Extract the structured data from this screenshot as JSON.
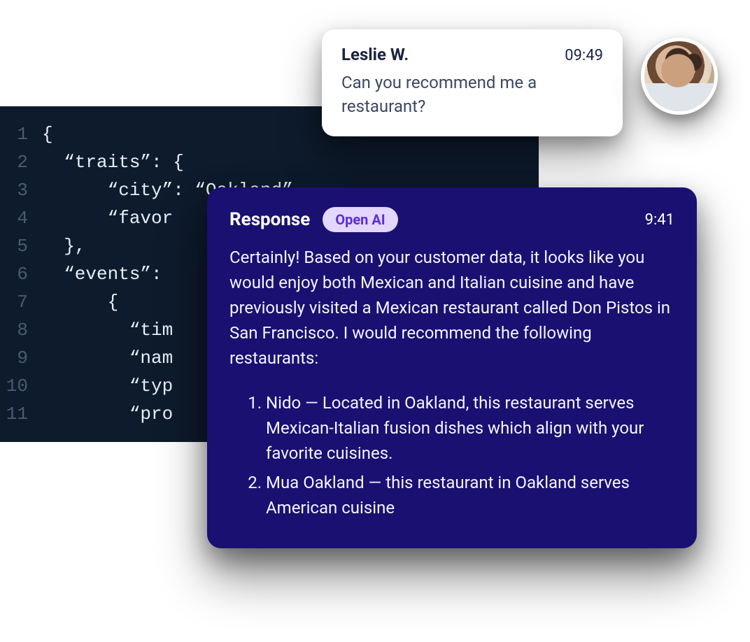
{
  "code": {
    "lines": [
      "{",
      "  “traits”: {",
      "      “city”: “Oakland”",
      "      “favor",
      "  },",
      "  “events”:",
      "      {",
      "        “tim",
      "        “nam",
      "        “typ",
      "        “pro"
    ]
  },
  "user_message": {
    "name": "Leslie W.",
    "time": "09:49",
    "text": "Can you recommend me a restaurant?"
  },
  "response": {
    "title": "Response",
    "badge": "Open AI",
    "time": "9:41",
    "intro": "Certainly! Based on your customer data, it looks like you would enjoy both Mexican and Italian cuisine and have previously visited a Mexican restaurant called Don Pistos in San Francisco. I would recommend the following restaurants:",
    "items": [
      "Nido — Located in Oakland, this restaurant serves Mexican-Italian fusion dishes which align with your favorite cuisines.",
      "Mua Oakland — this restaurant in Oakland serves American cuisine"
    ]
  }
}
